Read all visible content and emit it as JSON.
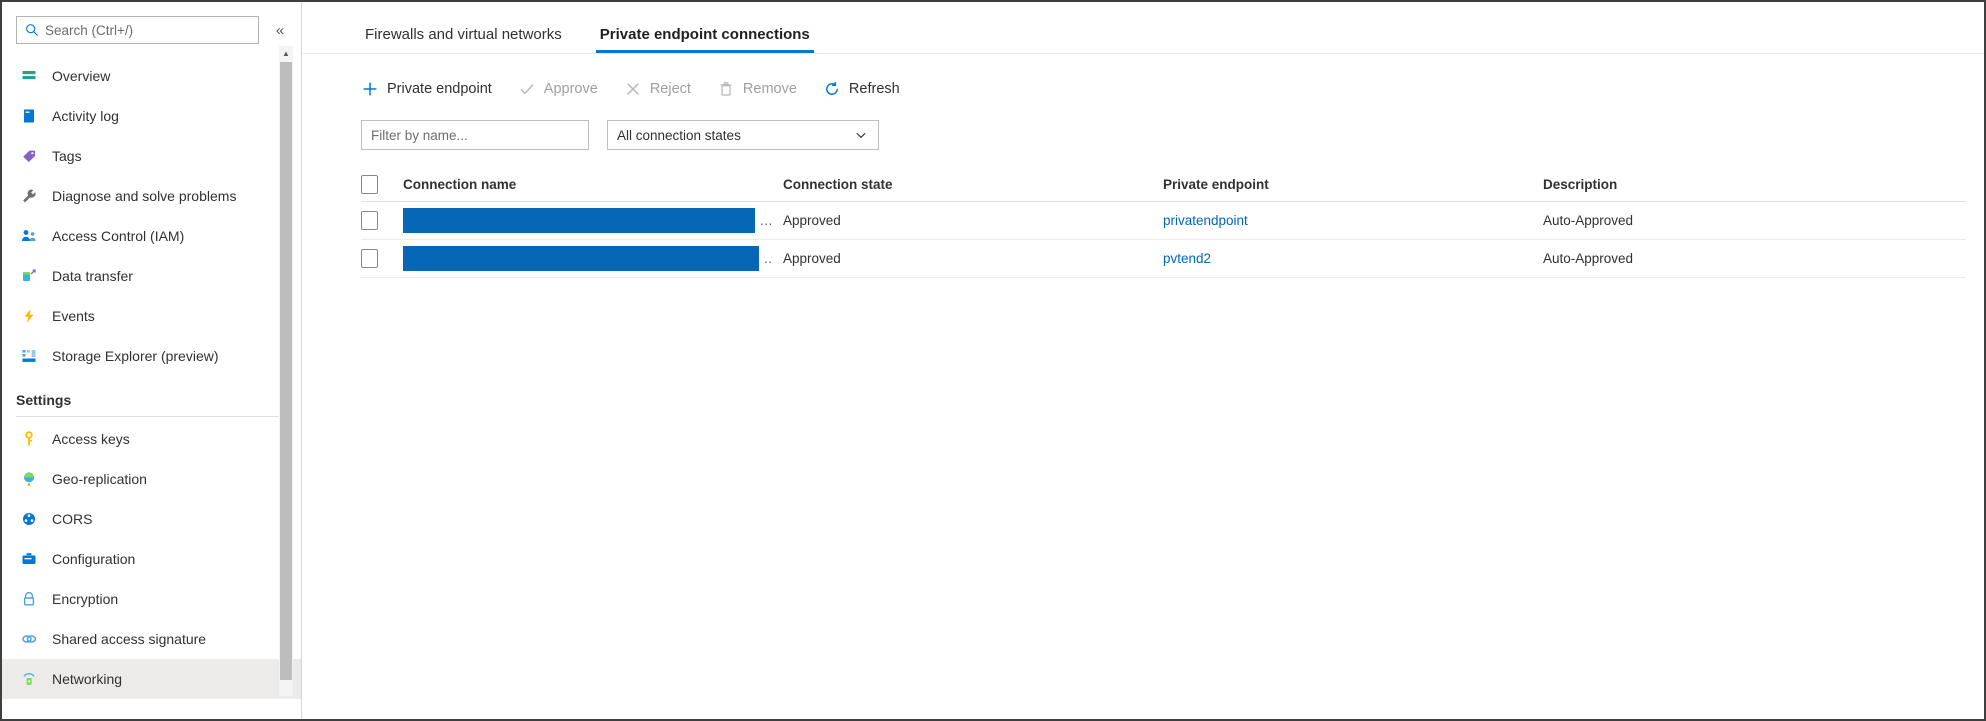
{
  "sidebar": {
    "search": {
      "placeholder": "Search (Ctrl+/)",
      "value": "",
      "icon": "search-icon"
    },
    "collapse": {
      "label": "«",
      "icon": "collapse-left-icon"
    },
    "items": [
      {
        "label": "Overview",
        "icon": "overview-icon",
        "selected": false
      },
      {
        "label": "Activity log",
        "icon": "activity-log-icon",
        "selected": false
      },
      {
        "label": "Tags",
        "icon": "tag-icon",
        "selected": false
      },
      {
        "label": "Diagnose and solve problems",
        "icon": "wrench-icon",
        "selected": false
      },
      {
        "label": "Access Control (IAM)",
        "icon": "access-control-icon",
        "selected": false
      },
      {
        "label": "Data transfer",
        "icon": "data-transfer-icon",
        "selected": false
      },
      {
        "label": "Events",
        "icon": "lightning-icon",
        "selected": false
      },
      {
        "label": "Storage Explorer (preview)",
        "icon": "storage-explorer-icon",
        "selected": false
      }
    ],
    "section_label": "Settings",
    "settings_items": [
      {
        "label": "Access keys",
        "icon": "key-icon",
        "selected": false
      },
      {
        "label": "Geo-replication",
        "icon": "globe-icon",
        "selected": false
      },
      {
        "label": "CORS",
        "icon": "cors-icon",
        "selected": false
      },
      {
        "label": "Configuration",
        "icon": "config-icon",
        "selected": false
      },
      {
        "label": "Encryption",
        "icon": "lock-icon",
        "selected": false
      },
      {
        "label": "Shared access signature",
        "icon": "link-icon",
        "selected": false
      },
      {
        "label": "Networking",
        "icon": "networking-icon",
        "selected": true
      }
    ]
  },
  "tabs": [
    {
      "label": "Firewalls and virtual networks",
      "active": false
    },
    {
      "label": "Private endpoint connections",
      "active": true
    }
  ],
  "toolbar": [
    {
      "label": "Private endpoint",
      "icon": "plus-icon",
      "disabled": false
    },
    {
      "label": "Approve",
      "icon": "check-icon",
      "disabled": true
    },
    {
      "label": "Reject",
      "icon": "cross-icon",
      "disabled": true
    },
    {
      "label": "Remove",
      "icon": "trash-icon",
      "disabled": true
    },
    {
      "label": "Refresh",
      "icon": "refresh-icon",
      "disabled": false
    }
  ],
  "filters": {
    "name_filter": {
      "placeholder": "Filter by name...",
      "value": ""
    },
    "state_filter": {
      "selected": "All connection states",
      "icon": "chevron-down-icon"
    }
  },
  "table": {
    "columns": [
      "Connection name",
      "Connection state",
      "Private endpoint",
      "Description"
    ],
    "rows": [
      {
        "connection_name": "",
        "redacted": true,
        "truncation": "...",
        "connection_state": "Approved",
        "private_endpoint": "privatendpoint",
        "description": "Auto-Approved"
      },
      {
        "connection_name": "",
        "redacted": true,
        "truncation": "..",
        "connection_state": "Approved",
        "private_endpoint": "pvtend2",
        "description": "Auto-Approved"
      }
    ]
  },
  "colors": {
    "accent": "#0078d4",
    "link": "#0067b8",
    "redaction": "#0567b5",
    "selected_nav": "#edebe9"
  }
}
